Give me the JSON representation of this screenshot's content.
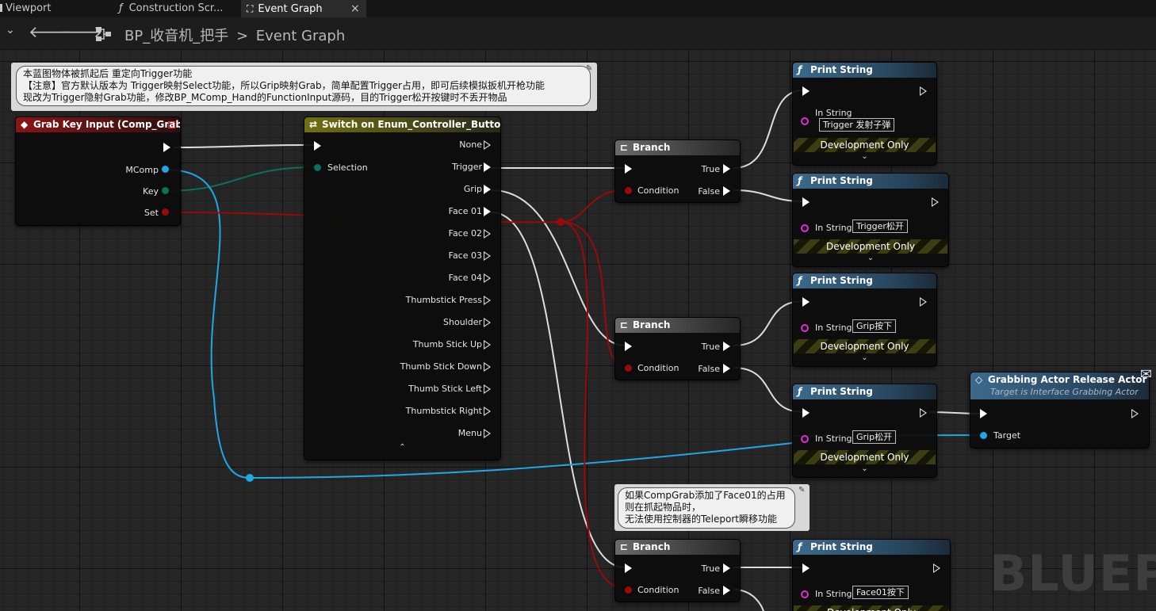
{
  "tabs": [
    {
      "label": "Viewport",
      "icon": "viewport-icon"
    },
    {
      "label": "Construction Scr...",
      "icon": "function-icon"
    },
    {
      "label": "Event Graph",
      "icon": "graph-icon",
      "close": "×"
    }
  ],
  "nav": {
    "blueprint": "BP_收音机_把手",
    "separator": ">",
    "graph": "Event Graph"
  },
  "watermark": "BLUEPRI",
  "comments": {
    "top": [
      "本蓝图物体被抓起后 重定向Trigger功能",
      "【注意】官方默认版本为 Trigger映射Select功能，所以Grip映射Grab，简单配置Trigger占用，即可后续模拟扳机开枪功能",
      "现改为Trigger隐射Grab功能，修改BP_MComp_Hand的FunctionInput源码，目的Trigger松开按键时不丢开物品"
    ],
    "bottom": [
      "如果CompGrab添加了Face01的占用",
      "则在抓起物品时，",
      "无法使用控制器的Teleport瞬移功能"
    ]
  },
  "grab_node": {
    "title": "Grab Key Input (Comp_Grab)",
    "pins": [
      "MComp",
      "Key",
      "Set"
    ]
  },
  "switch_node": {
    "title": "Switch on Enum_Controller_Buttons",
    "input": "Selection",
    "outputs": [
      "None",
      "Trigger",
      "Grip",
      "Face 01",
      "Face 02",
      "Face 03",
      "Face 04",
      "Thumbstick Press",
      "Shoulder",
      "Thumb Stick Up",
      "Thumb Stick Down",
      "Thumb Stick Left",
      "Thumbstick Right",
      "Menu"
    ],
    "collapse": "⌃"
  },
  "branch": {
    "title": "Branch",
    "condition": "Condition",
    "true": "True",
    "false": "False"
  },
  "print": {
    "title": "Print String",
    "in_string": "In String",
    "dev_only": "Development Only",
    "expand": "⌄"
  },
  "prints": [
    "Trigger 发射子弹",
    "Trigger松开",
    "Grip按下",
    "Grip松开",
    "Face01按下"
  ],
  "release_node": {
    "title": "Grabbing Actor Release Actor",
    "subtitle": "Target is Interface Grabbing Actor",
    "target": "Target"
  },
  "colors": {
    "exec": "#ffffff",
    "object": "#1ea8e8",
    "struct": "#0a7060",
    "bool": "#9a0a0a",
    "string": "#e02bd6"
  }
}
